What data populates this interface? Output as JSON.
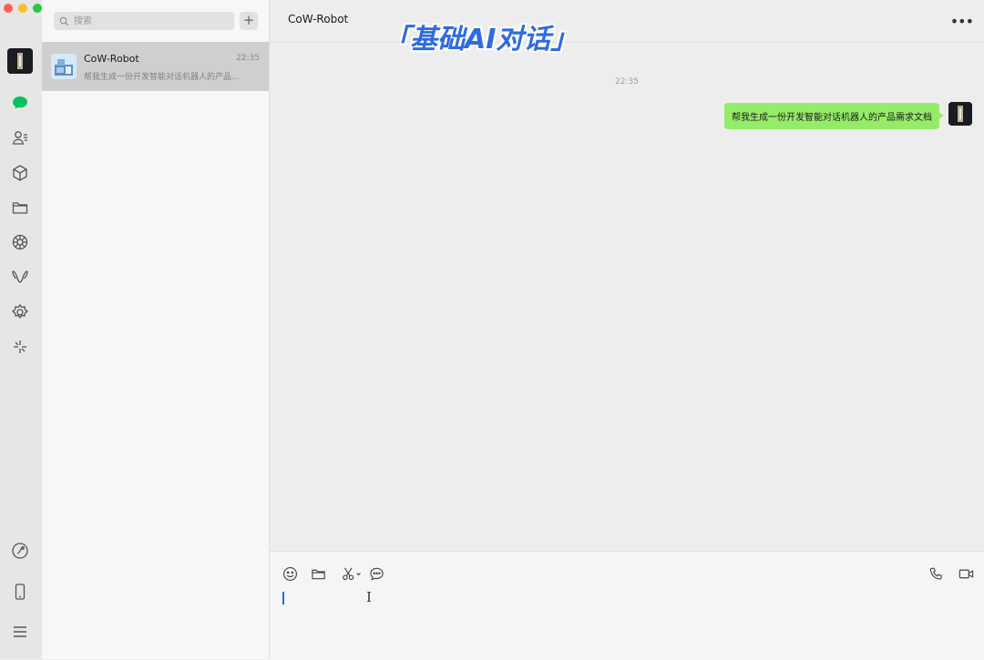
{
  "window": {
    "traffic_lights": {
      "close": "#ff5f57",
      "minimize": "#febc2e",
      "maximize": "#28c840"
    }
  },
  "sidebar": {
    "avatar": "user-avatar",
    "nav_icons": [
      "chat-icon",
      "contacts-icon",
      "cube-icon",
      "folder-icon",
      "moments-icon",
      "channels-icon",
      "mini-programs-icon",
      "sparkle-icon"
    ],
    "bottom_icons": [
      "link-icon",
      "phone-icon",
      "menu-icon"
    ],
    "active_color": "#07c160"
  },
  "search": {
    "placeholder": "搜索",
    "add_label": "+"
  },
  "conversations": [
    {
      "name": "CoW-Robot",
      "time": "22:35",
      "preview": "帮我生成一份开发智能对话机器人的产品..."
    }
  ],
  "chat": {
    "title": "CoW-Robot",
    "more_label": "•••",
    "overlay_title": "「基础AI对话」",
    "timestamp": "22:35",
    "messages": [
      {
        "sender": "self",
        "text": "帮我生成一份开发智能对话机器人的产品需求文档"
      }
    ]
  },
  "composer": {
    "left_tools": [
      "emoji-icon",
      "folder-icon",
      "scissors-icon",
      "chat-bubble-icon"
    ],
    "right_tools": [
      "phone-call-icon",
      "video-call-icon"
    ]
  },
  "colors": {
    "bubble": "#95ec69",
    "selected_item": "#cfcfcf",
    "overlay_text": "#2f6be0"
  }
}
